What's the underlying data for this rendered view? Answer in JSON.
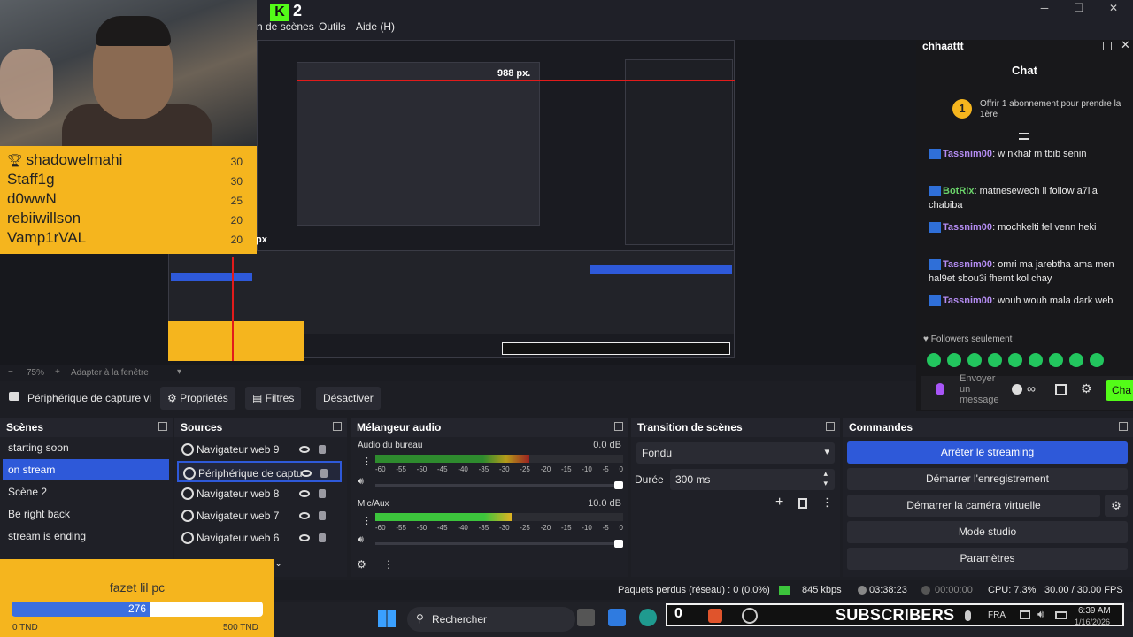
{
  "app": {
    "logo_text": "2",
    "menu": [
      "n de scènes",
      "Outils",
      "Aide (H)"
    ],
    "win_controls": [
      "─",
      "❐",
      "✕"
    ]
  },
  "leaderboard": [
    {
      "name": "shadowelmahi",
      "score": "30",
      "icon": "trophy-icon"
    },
    {
      "name": "Staff1g",
      "score": "30"
    },
    {
      "name": "d0wwN",
      "score": "25"
    },
    {
      "name": "rebiiwillson",
      "score": "20"
    },
    {
      "name": "Vamp1rVAL",
      "score": "20"
    }
  ],
  "preview": {
    "size_label": "988 px.",
    "px_label": "px"
  },
  "chat": {
    "window_title": "chhaattt",
    "header": "Chat",
    "gift_count": "1",
    "gift_text": "Offrir 1 abonnement pour prendre la 1ère",
    "messages": [
      {
        "user": "Tassnim00",
        "text": "w nkhaf m tbib senin"
      },
      {
        "user": "BotRix",
        "text": "matnesewech il follow a7lla chabiba"
      },
      {
        "user": "Tassnim00",
        "text": "mochkelti fel venn heki"
      },
      {
        "user": "Tassnim00",
        "text": "omri ma jarebtha ama men hal9et sbou3i fhemt kol chay"
      },
      {
        "user": "Tassnim00",
        "text": "wouh wouh mala dark web"
      }
    ],
    "followers_only": "Followers seulement",
    "input_placeholder": "Envoyer un message",
    "chat_button": "Cha"
  },
  "zoom": {
    "level": "75%",
    "fit": "Adapter à la fenêtre"
  },
  "source_toolbar": {
    "source_name": "Périphérique de capture vi",
    "properties": "Propriétés",
    "filters": "Filtres",
    "deactivate": "Désactiver"
  },
  "scenes": {
    "title": "Scènes",
    "items": [
      "starting soon",
      "on stream",
      "Scène 2",
      "Be right back",
      "stream is ending"
    ],
    "active_index": 1
  },
  "sources": {
    "title": "Sources",
    "items": [
      "Navigateur web 9",
      "Périphérique de captu",
      "Navigateur web 8",
      "Navigateur web 7",
      "Navigateur web 6"
    ],
    "active_index": 1
  },
  "mixer": {
    "title": "Mélangeur audio",
    "tracks": [
      {
        "name": "Audio du bureau",
        "db": "0.0 dB",
        "level": 0.62
      },
      {
        "name": "Mic/Aux",
        "db": "10.0 dB",
        "level": 0.55
      }
    ],
    "scale": [
      "-60",
      "-55",
      "-50",
      "-45",
      "-40",
      "-35",
      "-30",
      "-25",
      "-20",
      "-15",
      "-10",
      "-5",
      "0"
    ]
  },
  "transitions": {
    "title": "Transition de scènes",
    "selected": "Fondu",
    "duration_label": "Durée",
    "duration_value": "300 ms"
  },
  "commands": {
    "title": "Commandes",
    "buttons": [
      "Arrêter le streaming",
      "Démarrer l'enregistrement",
      "Démarrer la caméra virtuelle",
      "Mode studio",
      "Paramètres"
    ]
  },
  "goal": {
    "title": "fazet lil pc",
    "current": "276",
    "min": "0 TND",
    "max": "500 TND",
    "progress": 0.552
  },
  "status": {
    "dropped": "Paquets perdus (réseau) : 0 (0.0%)",
    "bitrate": "845 kbps",
    "stream_time": "03:38:23",
    "rec_time": "00:00:00",
    "cpu": "CPU: 7.3%",
    "fps": "30.00 / 30.00 FPS"
  },
  "taskbar": {
    "search": "Rechercher",
    "subscribers": "SUBSCRIBERS",
    "sub_count": "0",
    "lang": "FRA",
    "time": "6:39 AM",
    "date": "1/16/2026"
  },
  "colors": {
    "accent": "#2e59d9",
    "obs_bg": "#1d1e24",
    "leaderboard": "#f5b51e",
    "chat_user": "#b48cf2",
    "kick_green": "#53fc18"
  }
}
